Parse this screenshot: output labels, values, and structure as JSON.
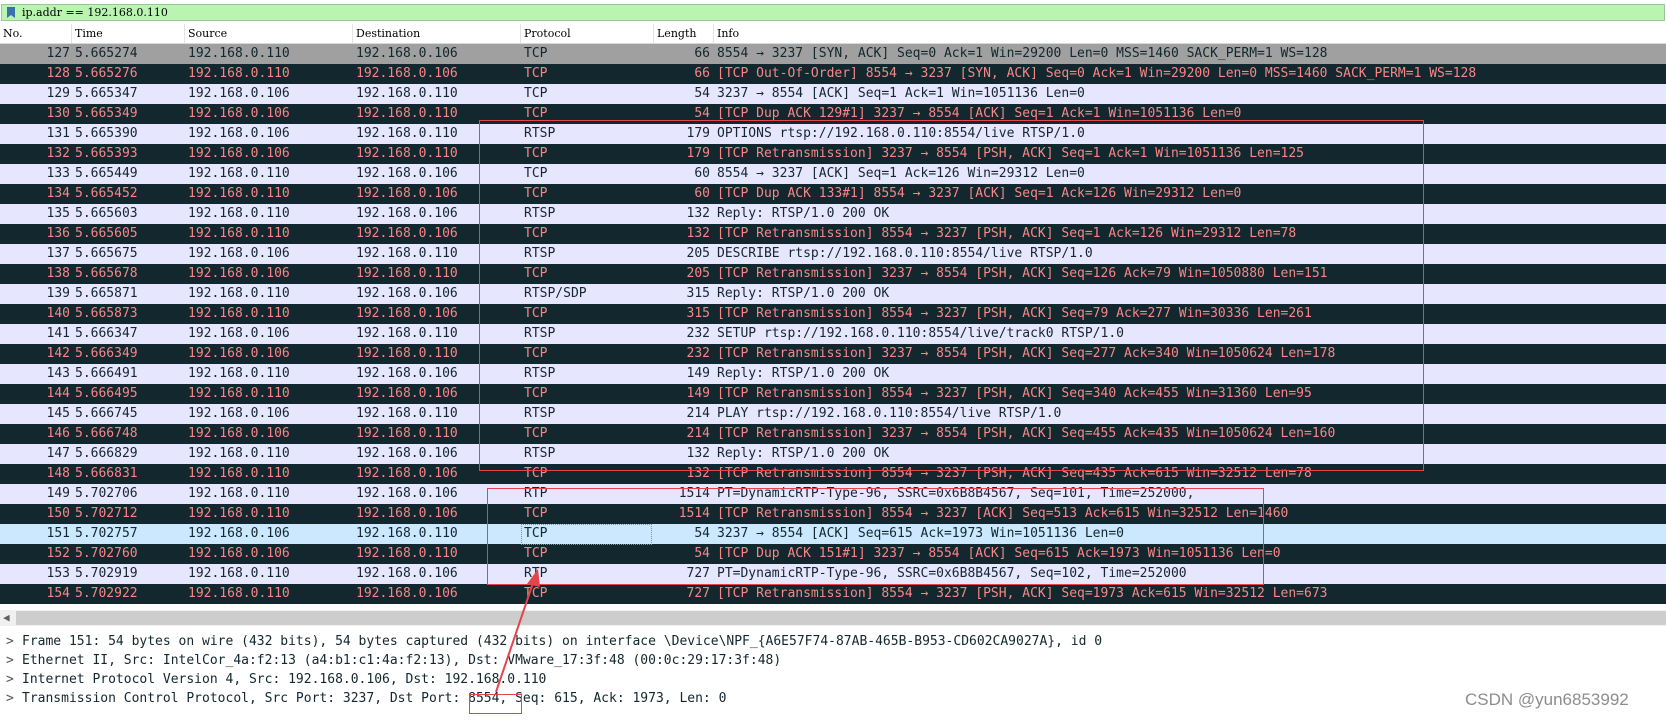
{
  "filter": {
    "value": "ip.addr == 192.168.0.110"
  },
  "columns": [
    "No.",
    "Time",
    "Source",
    "Destination",
    "Protocol",
    "Length",
    "Info"
  ],
  "packets": [
    {
      "no": "127",
      "time": "5.665274",
      "src": "192.168.0.110",
      "dst": "192.168.0.106",
      "proto": "TCP",
      "len": "66",
      "info": "8554 → 3237 [SYN, ACK] Seq=0 Ack=1 Win=29200 Len=0 MSS=1460 SACK_PERM=1 WS=128",
      "style": "gray"
    },
    {
      "no": "128",
      "time": "5.665276",
      "src": "192.168.0.110",
      "dst": "192.168.0.106",
      "proto": "TCP",
      "len": "66",
      "info": "[TCP Out-Of-Order] 8554 → 3237 [SYN, ACK] Seq=0 Ack=1 Win=29200 Len=0 MSS=1460 SACK_PERM=1 WS=128",
      "style": "bad"
    },
    {
      "no": "129",
      "time": "5.665347",
      "src": "192.168.0.106",
      "dst": "192.168.0.110",
      "proto": "TCP",
      "len": "54",
      "info": "3237 → 8554 [ACK] Seq=1 Ack=1 Win=1051136 Len=0",
      "style": "tcp"
    },
    {
      "no": "130",
      "time": "5.665349",
      "src": "192.168.0.106",
      "dst": "192.168.0.110",
      "proto": "TCP",
      "len": "54",
      "info": "[TCP Dup ACK 129#1] 3237 → 8554 [ACK] Seq=1 Ack=1 Win=1051136 Len=0",
      "style": "bad"
    },
    {
      "no": "131",
      "time": "5.665390",
      "src": "192.168.0.106",
      "dst": "192.168.0.110",
      "proto": "RTSP",
      "len": "179",
      "info": "OPTIONS rtsp://192.168.0.110:8554/live RTSP/1.0",
      "style": "rtsp"
    },
    {
      "no": "132",
      "time": "5.665393",
      "src": "192.168.0.106",
      "dst": "192.168.0.110",
      "proto": "TCP",
      "len": "179",
      "info": "[TCP Retransmission] 3237 → 8554 [PSH, ACK] Seq=1 Ack=1 Win=1051136 Len=125",
      "style": "bad"
    },
    {
      "no": "133",
      "time": "5.665449",
      "src": "192.168.0.110",
      "dst": "192.168.0.106",
      "proto": "TCP",
      "len": "60",
      "info": "8554 → 3237 [ACK] Seq=1 Ack=126 Win=29312 Len=0",
      "style": "tcp"
    },
    {
      "no": "134",
      "time": "5.665452",
      "src": "192.168.0.110",
      "dst": "192.168.0.106",
      "proto": "TCP",
      "len": "60",
      "info": "[TCP Dup ACK 133#1] 8554 → 3237 [ACK] Seq=1 Ack=126 Win=29312 Len=0",
      "style": "bad"
    },
    {
      "no": "135",
      "time": "5.665603",
      "src": "192.168.0.110",
      "dst": "192.168.0.106",
      "proto": "RTSP",
      "len": "132",
      "info": "Reply: RTSP/1.0 200 OK",
      "style": "rtsp"
    },
    {
      "no": "136",
      "time": "5.665605",
      "src": "192.168.0.110",
      "dst": "192.168.0.106",
      "proto": "TCP",
      "len": "132",
      "info": "[TCP Retransmission] 8554 → 3237 [PSH, ACK] Seq=1 Ack=126 Win=29312 Len=78",
      "style": "bad"
    },
    {
      "no": "137",
      "time": "5.665675",
      "src": "192.168.0.106",
      "dst": "192.168.0.110",
      "proto": "RTSP",
      "len": "205",
      "info": "DESCRIBE rtsp://192.168.0.110:8554/live RTSP/1.0",
      "style": "rtsp"
    },
    {
      "no": "138",
      "time": "5.665678",
      "src": "192.168.0.106",
      "dst": "192.168.0.110",
      "proto": "TCP",
      "len": "205",
      "info": "[TCP Retransmission] 3237 → 8554 [PSH, ACK] Seq=126 Ack=79 Win=1050880 Len=151",
      "style": "bad"
    },
    {
      "no": "139",
      "time": "5.665871",
      "src": "192.168.0.110",
      "dst": "192.168.0.106",
      "proto": "RTSP/SDP",
      "len": "315",
      "info": "Reply: RTSP/1.0 200 OK",
      "style": "rtsp"
    },
    {
      "no": "140",
      "time": "5.665873",
      "src": "192.168.0.110",
      "dst": "192.168.0.106",
      "proto": "TCP",
      "len": "315",
      "info": "[TCP Retransmission] 8554 → 3237 [PSH, ACK] Seq=79 Ack=277 Win=30336 Len=261",
      "style": "bad"
    },
    {
      "no": "141",
      "time": "5.666347",
      "src": "192.168.0.106",
      "dst": "192.168.0.110",
      "proto": "RTSP",
      "len": "232",
      "info": "SETUP rtsp://192.168.0.110:8554/live/track0 RTSP/1.0",
      "style": "rtsp"
    },
    {
      "no": "142",
      "time": "5.666349",
      "src": "192.168.0.106",
      "dst": "192.168.0.110",
      "proto": "TCP",
      "len": "232",
      "info": "[TCP Retransmission] 3237 → 8554 [PSH, ACK] Seq=277 Ack=340 Win=1050624 Len=178",
      "style": "bad"
    },
    {
      "no": "143",
      "time": "5.666491",
      "src": "192.168.0.110",
      "dst": "192.168.0.106",
      "proto": "RTSP",
      "len": "149",
      "info": "Reply: RTSP/1.0 200 OK",
      "style": "rtsp"
    },
    {
      "no": "144",
      "time": "5.666495",
      "src": "192.168.0.110",
      "dst": "192.168.0.106",
      "proto": "TCP",
      "len": "149",
      "info": "[TCP Retransmission] 8554 → 3237 [PSH, ACK] Seq=340 Ack=455 Win=31360 Len=95",
      "style": "bad"
    },
    {
      "no": "145",
      "time": "5.666745",
      "src": "192.168.0.106",
      "dst": "192.168.0.110",
      "proto": "RTSP",
      "len": "214",
      "info": "PLAY rtsp://192.168.0.110:8554/live RTSP/1.0",
      "style": "rtsp"
    },
    {
      "no": "146",
      "time": "5.666748",
      "src": "192.168.0.106",
      "dst": "192.168.0.110",
      "proto": "TCP",
      "len": "214",
      "info": "[TCP Retransmission] 3237 → 8554 [PSH, ACK] Seq=455 Ack=435 Win=1050624 Len=160",
      "style": "bad"
    },
    {
      "no": "147",
      "time": "5.666829",
      "src": "192.168.0.110",
      "dst": "192.168.0.106",
      "proto": "RTSP",
      "len": "132",
      "info": "Reply: RTSP/1.0 200 OK",
      "style": "rtsp"
    },
    {
      "no": "148",
      "time": "5.666831",
      "src": "192.168.0.110",
      "dst": "192.168.0.106",
      "proto": "TCP",
      "len": "132",
      "info": "[TCP Retransmission] 8554 → 3237 [PSH, ACK] Seq=435 Ack=615 Win=32512 Len=78",
      "style": "bad"
    },
    {
      "no": "149",
      "time": "5.702706",
      "src": "192.168.0.110",
      "dst": "192.168.0.106",
      "proto": "RTP",
      "len": "1514",
      "info": "PT=DynamicRTP-Type-96, SSRC=0x6B8B4567, Seq=101, Time=252000,",
      "style": "rtp"
    },
    {
      "no": "150",
      "time": "5.702712",
      "src": "192.168.0.110",
      "dst": "192.168.0.106",
      "proto": "TCP",
      "len": "1514",
      "info": "[TCP Retransmission] 8554 → 3237 [ACK] Seq=513 Ack=615 Win=32512 Len=1460",
      "style": "bad"
    },
    {
      "no": "151",
      "time": "5.702757",
      "src": "192.168.0.106",
      "dst": "192.168.0.110",
      "proto": "TCP",
      "len": "54",
      "info": "3237 → 8554 [ACK] Seq=615 Ack=1973 Win=1051136 Len=0",
      "style": "sel"
    },
    {
      "no": "152",
      "time": "5.702760",
      "src": "192.168.0.106",
      "dst": "192.168.0.110",
      "proto": "TCP",
      "len": "54",
      "info": "[TCP Dup ACK 151#1] 3237 → 8554 [ACK] Seq=615 Ack=1973 Win=1051136 Len=0",
      "style": "bad"
    },
    {
      "no": "153",
      "time": "5.702919",
      "src": "192.168.0.110",
      "dst": "192.168.0.106",
      "proto": "RTP",
      "len": "727",
      "info": "PT=DynamicRTP-Type-96, SSRC=0x6B8B4567, Seq=102, Time=252000",
      "style": "rtp"
    },
    {
      "no": "154",
      "time": "5.702922",
      "src": "192.168.0.110",
      "dst": "192.168.0.106",
      "proto": "TCP",
      "len": "727",
      "info": "[TCP Retransmission] 8554 → 3237 [PSH, ACK] Seq=1973 Ack=615 Win=32512 Len=673",
      "style": "bad"
    }
  ],
  "details": [
    "Frame 151: 54 bytes on wire (432 bits), 54 bytes captured (432 bits) on interface \\Device\\NPF_{A6E57F74-87AB-465B-B953-CD602CA9027A}, id 0",
    "Ethernet II, Src: IntelCor_4a:f2:13 (a4:b1:c1:4a:f2:13), Dst: VMware_17:3f:48 (00:0c:29:17:3f:48)",
    "Internet Protocol Version 4, Src: 192.168.0.106, Dst: 192.168.0.110",
    "Transmission Control Protocol, Src Port: 3237, Dst Port: 8554, Seq: 615, Ack: 1973, Len: 0"
  ],
  "watermark": "CSDN @yun6853992"
}
